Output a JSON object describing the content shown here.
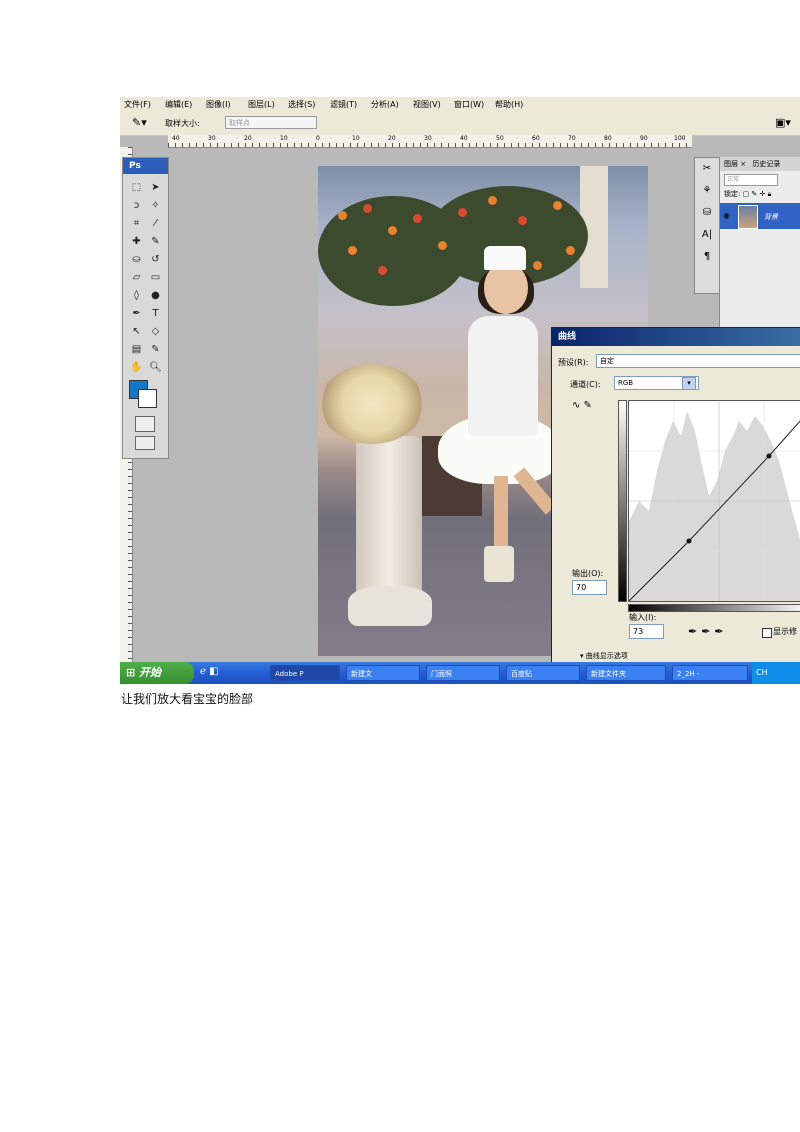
{
  "menu": [
    "文件(F)",
    "编辑(E)",
    "图像(I)",
    "图层(L)",
    "选择(S)",
    "滤镜(T)",
    "分析(A)",
    "视图(V)",
    "窗口(W)",
    "帮助(H)"
  ],
  "options": {
    "sample_label": "取样大小:",
    "sample_value": "取样点"
  },
  "ruler_ticks": [
    "40",
    "30",
    "20",
    "10",
    "0",
    "10",
    "20",
    "30",
    "40",
    "50",
    "60",
    "70",
    "80",
    "90",
    "100"
  ],
  "toolbox": {
    "logo": "Ps",
    "foreground_color": "#1478c8",
    "background_color": "#ffffff"
  },
  "layers_panel": {
    "tab_layers": "图层 ×",
    "tab_history": "历史记录",
    "blend_mode": "正常",
    "lock_label": "锁定:",
    "layer_name": "背景"
  },
  "curves_dialog": {
    "title": "曲线",
    "preset_label": "预设(R):",
    "preset_value": "自定",
    "channel_label": "通道(C):",
    "channel_value": "RGB",
    "output_label": "输出(O):",
    "output_value": "70",
    "input_label": "输入(I):",
    "input_value": "73",
    "show_clipping_label": "显示修",
    "more_label": "曲线显示选项"
  },
  "taskbar": {
    "start_label": "开始",
    "tasks": [
      "Adobe P",
      "新建文",
      "门面照",
      "百度贴",
      "新建文件夹",
      "2_2H -"
    ],
    "tray_text": "CH"
  },
  "caption": "让我们放大看宝宝的脸部"
}
